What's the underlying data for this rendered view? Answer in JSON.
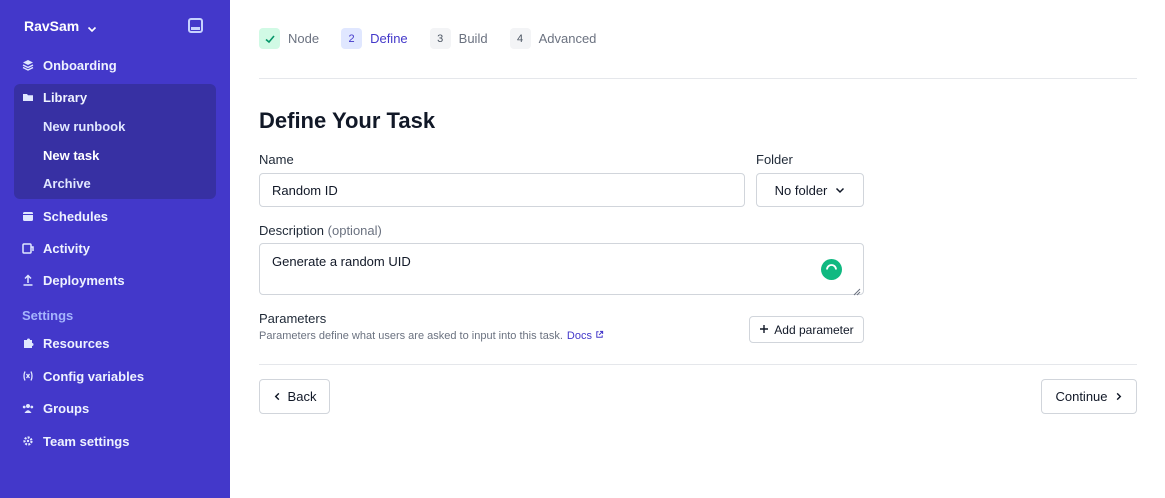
{
  "sidebar": {
    "workspace": "RavSam",
    "items": [
      {
        "label": "Onboarding",
        "icon": "stack-icon"
      },
      {
        "label": "Library",
        "icon": "folder-icon"
      },
      {
        "label": "Schedules",
        "icon": "calendar-icon"
      },
      {
        "label": "Activity",
        "icon": "activity-icon"
      },
      {
        "label": "Deployments",
        "icon": "upload-icon"
      }
    ],
    "library_sub": [
      "New runbook",
      "New task",
      "Archive"
    ],
    "settings_label": "Settings",
    "settings_items": [
      {
        "label": "Resources",
        "icon": "puzzle-icon"
      },
      {
        "label": "Config variables",
        "icon": "variable-icon"
      },
      {
        "label": "Groups",
        "icon": "users-icon"
      },
      {
        "label": "Team settings",
        "icon": "gear-icon"
      }
    ]
  },
  "stepper": [
    {
      "num": "✓",
      "label": "Node",
      "state": "done"
    },
    {
      "num": "2",
      "label": "Define",
      "state": "current"
    },
    {
      "num": "3",
      "label": "Build",
      "state": "todo"
    },
    {
      "num": "4",
      "label": "Advanced",
      "state": "todo"
    }
  ],
  "form": {
    "title": "Define Your Task",
    "name_label": "Name",
    "name_value": "Random ID",
    "folder_label": "Folder",
    "folder_value": "No folder",
    "description_label": "Description",
    "description_optional": "(optional)",
    "description_value": "Generate a random UID",
    "parameters_title": "Parameters",
    "parameters_help": "Parameters define what users are asked to input into this task.",
    "docs_link": "Docs",
    "add_parameter": "Add parameter"
  },
  "footer": {
    "back": "Back",
    "continue": "Continue"
  },
  "colors": {
    "sidebar_bg": "#4338ca",
    "sidebar_group_bg": "#3730a3",
    "accent": "#4338ca",
    "success": "#10b981"
  }
}
